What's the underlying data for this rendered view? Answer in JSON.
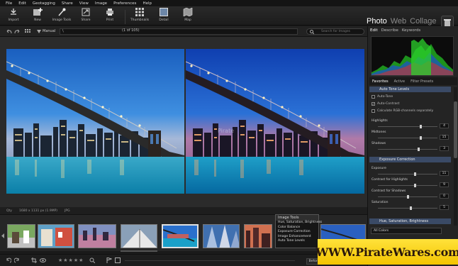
{
  "menubar": [
    "File",
    "Edit",
    "Geotagging",
    "Share",
    "View",
    "Image",
    "Preferences",
    "Help"
  ],
  "toolbar": {
    "import": "Import",
    "new": "New",
    "image_tools": "Image Tools",
    "share": "Share",
    "print": "Print",
    "thumbnails": "Thumbnails",
    "detail": "Detail",
    "map": "Map"
  },
  "modes": {
    "photo": "Photo",
    "web": "Web",
    "collage": "Collage"
  },
  "subbar": {
    "mode": "Manual",
    "path": "\\",
    "count": "(1 of 105)",
    "search_placeholder": "Search for Images"
  },
  "viewer": {
    "watermark": "Pirate"
  },
  "status": {
    "label": "Qty",
    "dims": "1680 x 1131 px (1.9MP)",
    "format": "JPG"
  },
  "popup": {
    "title": "Image Tools",
    "items": [
      "Hue, Saturation, Brightness",
      "Color Balance",
      "Exposure Correction",
      "Image Enhancement",
      "Auto Tone Levels"
    ]
  },
  "bottom": {
    "stars": "★★★★★",
    "before": "Before"
  },
  "right": {
    "tabs": [
      "Edit",
      "Describe",
      "Keywords"
    ],
    "panel_tabs": [
      "Favorites",
      "Active",
      "Filter Presets"
    ],
    "auto_tone": {
      "title": "Auto Tone Levels",
      "checks": [
        {
          "label": "Auto-Tone",
          "checked": false
        },
        {
          "label": "Auto-Contrast",
          "checked": true
        },
        {
          "label": "Calculate RGB-channels separately",
          "checked": false
        }
      ],
      "sliders": [
        {
          "label": "Highlights",
          "value": "4",
          "pos": 0.72
        },
        {
          "label": "Midtones",
          "value": "15",
          "pos": 0.72
        },
        {
          "label": "Shadows",
          "value": "3",
          "pos": 0.68
        }
      ]
    },
    "exposure": {
      "title": "Exposure Correction",
      "sliders": [
        {
          "label": "Exposure",
          "value": "11",
          "pos": 0.62
        },
        {
          "label": "Contrast for Highlights",
          "value": "9",
          "pos": 0.62
        },
        {
          "label": "Contrast for Shadows",
          "value": "0",
          "pos": 0.5
        },
        {
          "label": "Saturation",
          "value": "5",
          "pos": 0.55
        }
      ]
    },
    "hsb": {
      "title": "Hue, Saturation, Brightness",
      "select": "All Colors"
    }
  },
  "banner": "WWW.PirateWares.com"
}
